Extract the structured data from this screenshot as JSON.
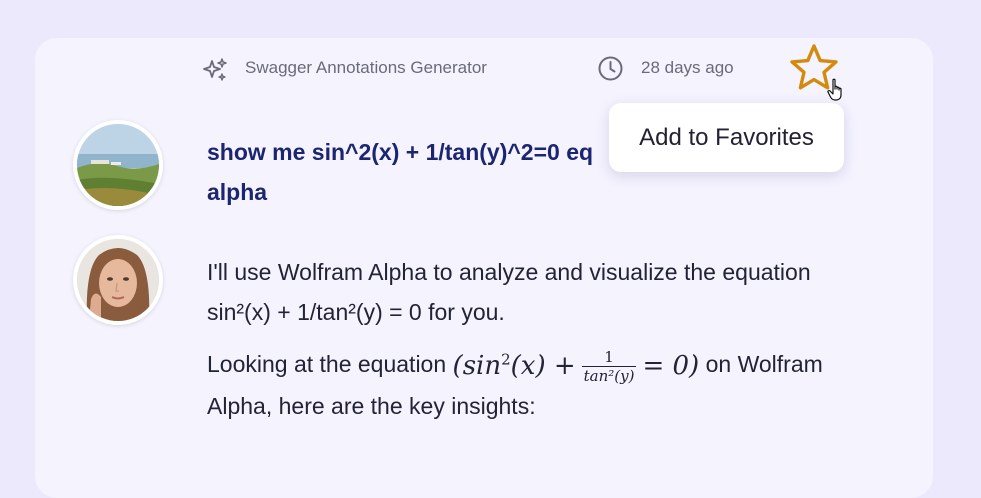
{
  "header": {
    "generator_icon": "sparkle-icon",
    "generator_name": "Swagger Annotations Generator",
    "clock_icon": "clock-icon",
    "timestamp": "28 days ago",
    "favorite_icon": "star-icon",
    "tooltip": "Add to Favorites"
  },
  "conversation": {
    "user": {
      "line1": "show me sin^2(x) + 1/tan(y)^2=0 eq",
      "line2": "alpha"
    },
    "assistant": {
      "para1": "I'll use Wolfram Alpha to analyze and visualize the equation sin²(x) + 1/tan²(y) = 0 for you.",
      "para2_before": "Looking at the equation",
      "math_left": "(sin",
      "math_exp": "2",
      "math_x": "(x) +",
      "frac_num": "1",
      "frac_den": "tan²(y)",
      "math_right": "= 0)",
      "para2_after": "on Wolfram Alpha, here are the key insights:"
    }
  },
  "colors": {
    "background": "#ebe9fb",
    "card": "#f4f3fe",
    "star": "#d38b0c",
    "user_text": "#1c2670"
  }
}
